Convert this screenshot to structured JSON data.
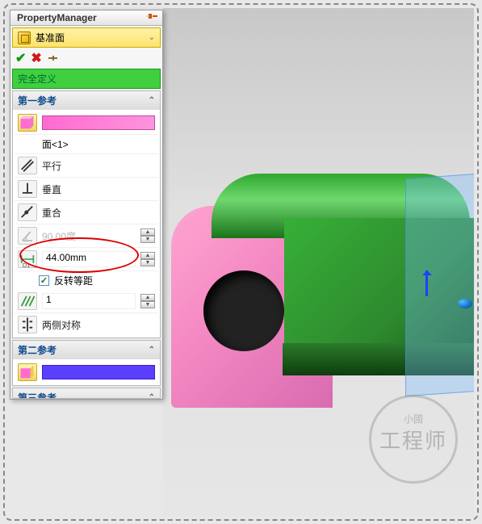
{
  "pm": {
    "title": "PropertyManager"
  },
  "feature": {
    "name": "基准面"
  },
  "status": "完全定义",
  "ref1": {
    "title": "第一参考",
    "face_label": "面<1>",
    "parallel": "平行",
    "perpendicular": "垂直",
    "coincident": "重合",
    "angle": "90.00度",
    "distance": "44.00mm",
    "reverse": "反转等距",
    "instances": "1",
    "symmetric": "两侧对称"
  },
  "ref2": {
    "title": "第二参考"
  },
  "ref3": {
    "title": "第三参考"
  },
  "watermark": {
    "sub": "小國",
    "main": "工程师"
  }
}
